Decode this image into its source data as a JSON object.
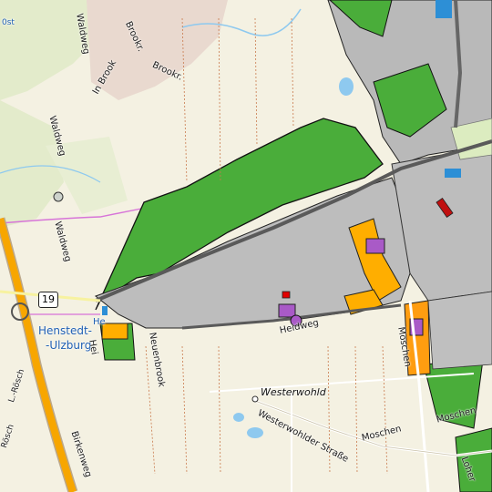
{
  "map": {
    "colors": {
      "background": "#f4f1e2",
      "forest": "#dfe8c6",
      "green_area": "#4aad3a",
      "industrial": "#bdbdbd",
      "commercial": "#ffae00",
      "residential_special": "#a95ac7",
      "highway": "#f7a600",
      "water": "#8ec9ef",
      "boundary": "#d774d8"
    },
    "labels": {
      "ost": "0st",
      "waldweg_top": "Waldweg",
      "brookr_1": "Brookr.",
      "brookr_2": "Brookr.",
      "in_brook": "In Brook",
      "waldweg_left": "Waldweg",
      "waldweg_lower": "Waldweg",
      "henstedt_1": "Henstedt-",
      "henstedt_2": "-Ulzburg",
      "he_partial": "He",
      "heidweg": "Heidweg",
      "neuenbrook": "Neuenbrook",
      "heidweg_lower": "Hei",
      "westerwohld": "Westerwohld",
      "westerwohlder_strasse": "Westerwohlder Straße",
      "moschen_1": "Moschen",
      "moschen_2": "Moschen",
      "moschen_vertical": "Moschen",
      "birkenweg": "Birkenweg",
      "l_rosch_1": "L.-Rösch",
      "l_rosch_2": "Rösch",
      "loher": "Loher",
      "route_19": "19"
    }
  }
}
